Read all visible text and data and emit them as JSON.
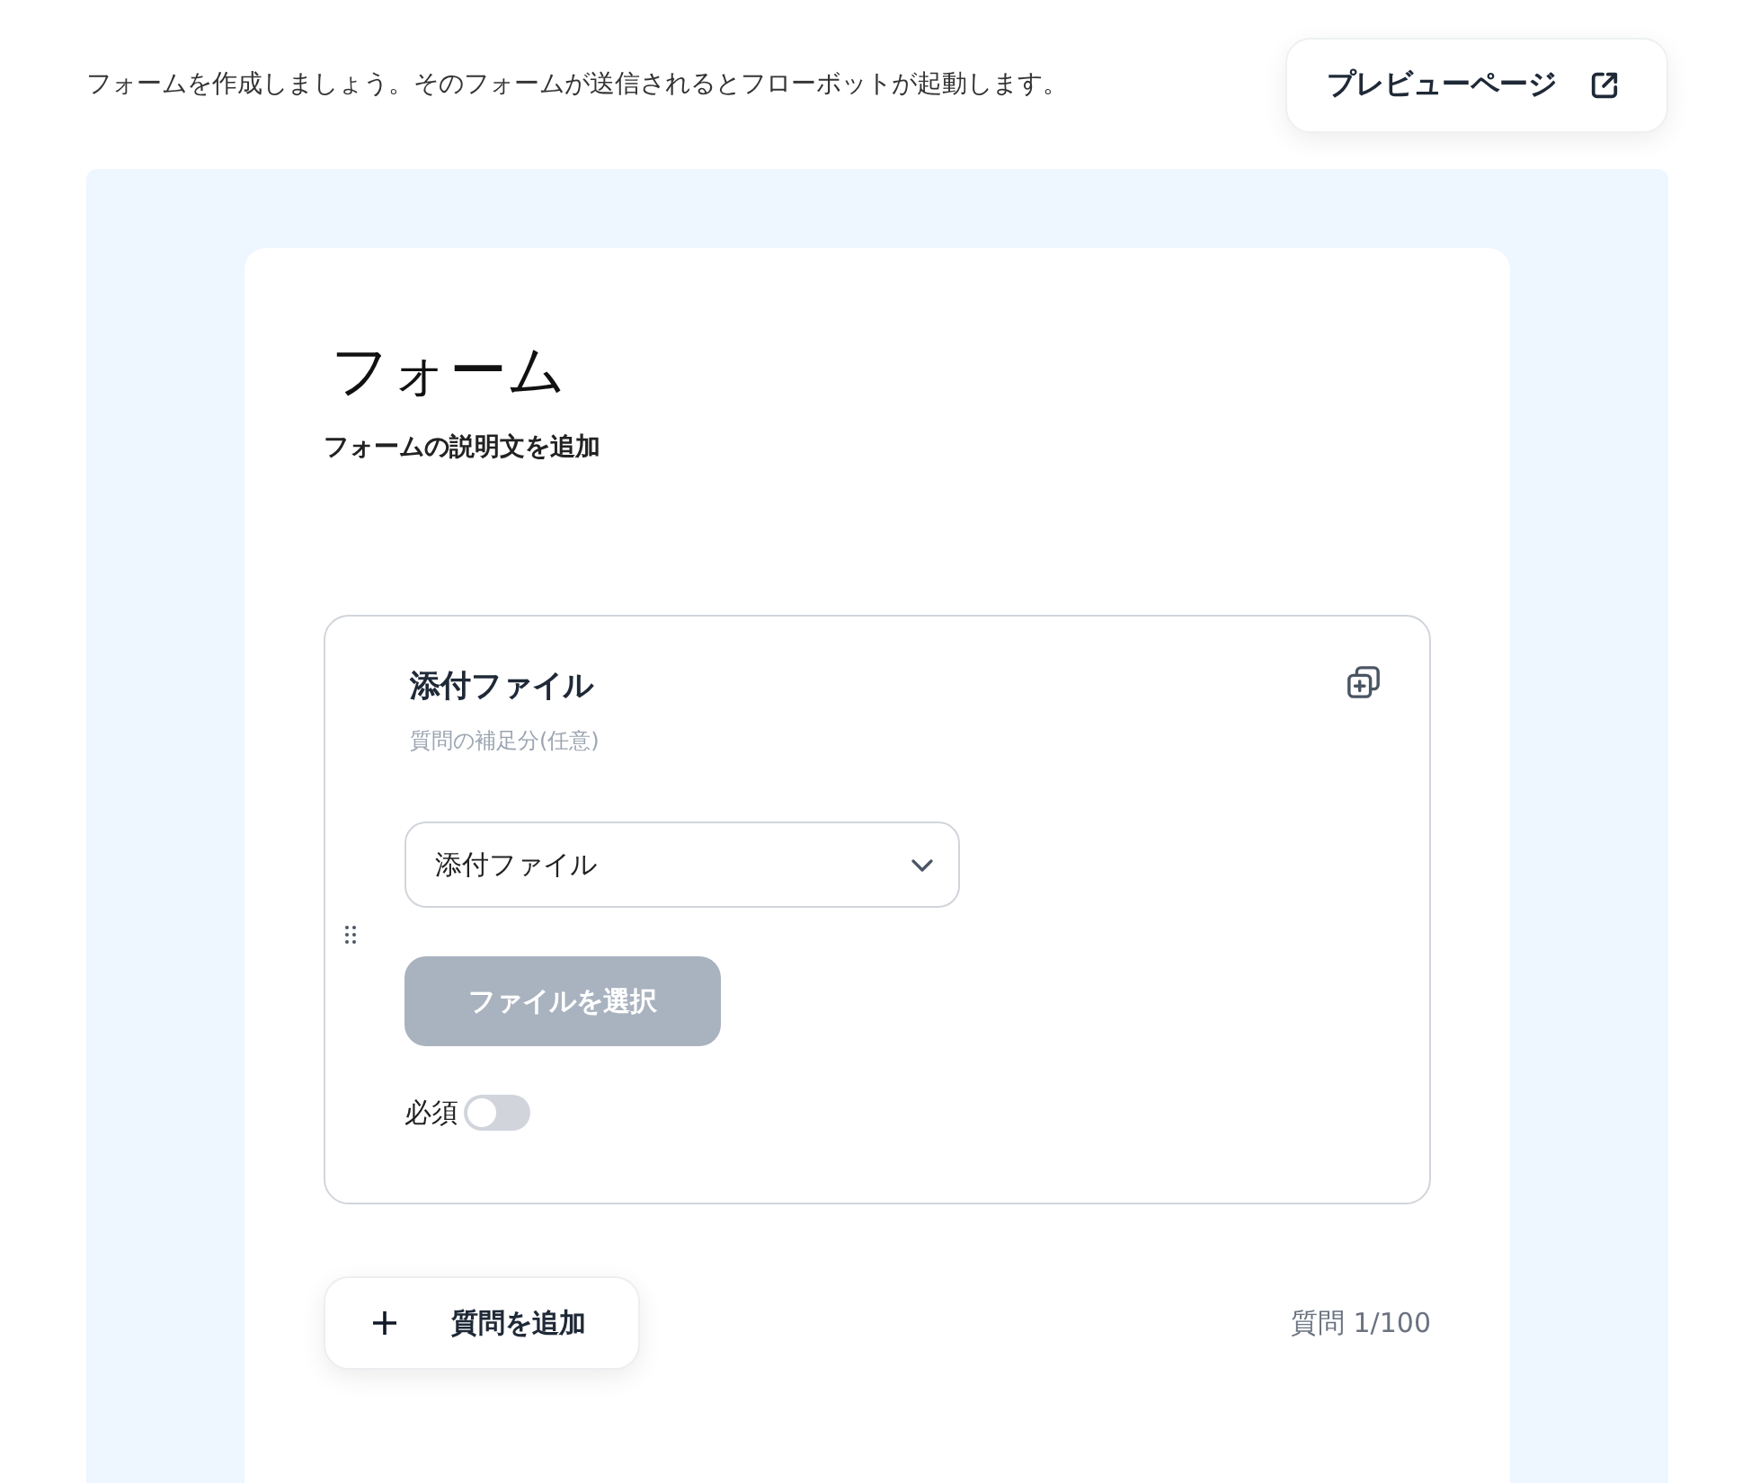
{
  "header": {
    "intro": "フォームを作成しましょう。そのフォームが送信されるとフローボットが起動します。",
    "preview_button": "プレビューページ"
  },
  "form": {
    "title": "フォーム",
    "description": "フォームの説明文を追加",
    "questions": [
      {
        "title": "添付ファイル",
        "placeholder": "質問の補足分(任意)",
        "type_select": "添付ファイル",
        "file_button": {
          "label": "ファイルを選択",
          "disabled": true
        },
        "required": {
          "label": "必須",
          "on": false
        }
      }
    ],
    "add_question_button": "質問を追加",
    "question_count": "質問 1/100"
  }
}
